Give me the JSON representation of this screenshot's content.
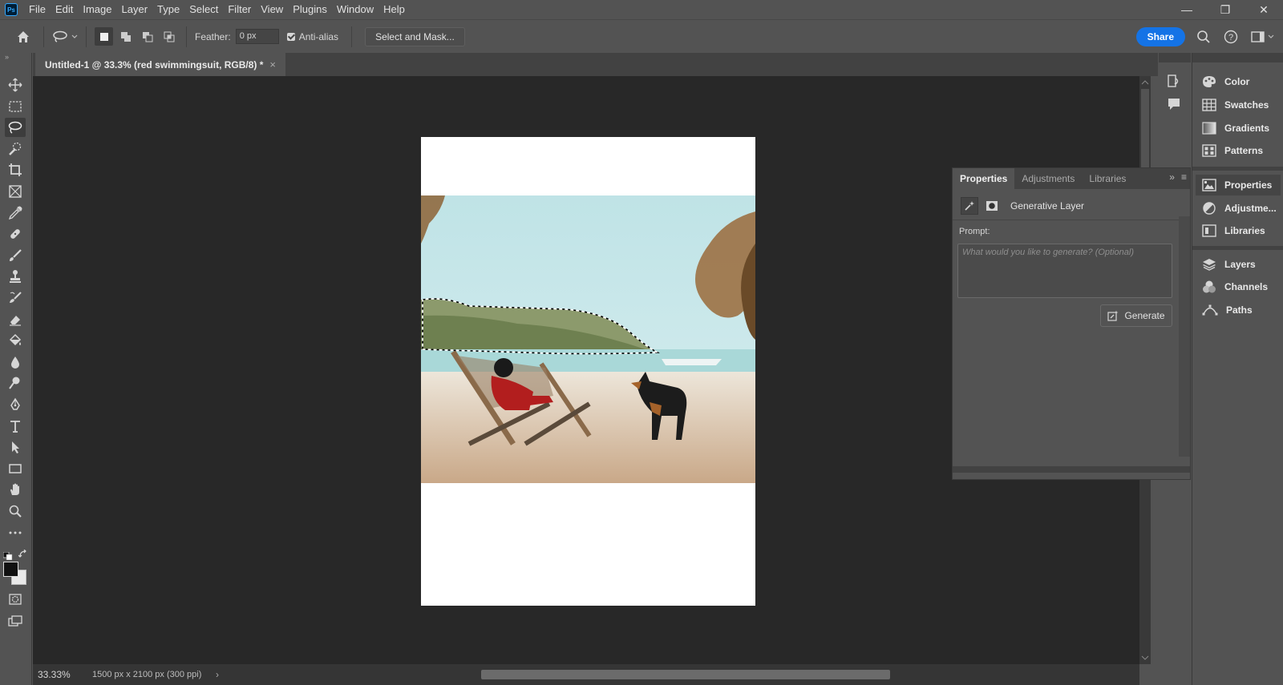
{
  "app": {
    "logo": "Ps"
  },
  "menu": [
    "File",
    "Edit",
    "Image",
    "Layer",
    "Type",
    "Select",
    "Filter",
    "View",
    "Plugins",
    "Window",
    "Help"
  ],
  "window_controls": {
    "minimize": "—",
    "restore": "❐",
    "close": "✕"
  },
  "options": {
    "feather_label": "Feather:",
    "feather_value": "0 px",
    "antialias_label": "Anti-alias",
    "antialias_checked": true,
    "select_mask_label": "Select and Mask...",
    "share_label": "Share"
  },
  "tools": [
    "move",
    "marquee",
    "lasso",
    "quick-selection",
    "crop",
    "frame",
    "eyedropper",
    "spot-healing",
    "brush",
    "clone-stamp",
    "history-brush",
    "eraser",
    "paint-bucket",
    "blur",
    "dodge",
    "pen",
    "type",
    "path-selection",
    "rectangle",
    "hand",
    "zoom",
    "more",
    "swap",
    "color-swatch",
    "quick-mask",
    "screen-mode"
  ],
  "active_tool": "lasso",
  "document": {
    "tab_title": "Untitled-1 @ 33.3% (red swimmingsuit, RGB/8) *",
    "close": "×"
  },
  "status": {
    "zoom": "33.33%",
    "doc_info": "1500 px x 2100 px (300 ppi)",
    "arrow": "›"
  },
  "panels_column": [
    {
      "label": "Color",
      "icon": "color-palette-icon"
    },
    {
      "label": "Swatches",
      "icon": "swatches-grid-icon"
    },
    {
      "label": "Gradients",
      "icon": "gradient-icon"
    },
    {
      "label": "Patterns",
      "icon": "patterns-icon"
    },
    {
      "label": "Properties",
      "icon": "properties-icon"
    },
    {
      "label": "Adjustme...",
      "icon": "adjustments-icon"
    },
    {
      "label": "Libraries",
      "icon": "libraries-icon"
    },
    {
      "label": "Layers",
      "icon": "layers-icon"
    },
    {
      "label": "Channels",
      "icon": "channels-icon"
    },
    {
      "label": "Paths",
      "icon": "paths-icon"
    }
  ],
  "properties_panel": {
    "tabs": [
      "Properties",
      "Adjustments",
      "Libraries"
    ],
    "layer_label": "Generative Layer",
    "prompt_label": "Prompt:",
    "prompt_placeholder": "What would you like to generate? (Optional)",
    "generate_label": "Generate"
  },
  "colors": {
    "accent": "#1473e6",
    "canvas_bg": "#282828",
    "panel_bg": "#535353"
  }
}
